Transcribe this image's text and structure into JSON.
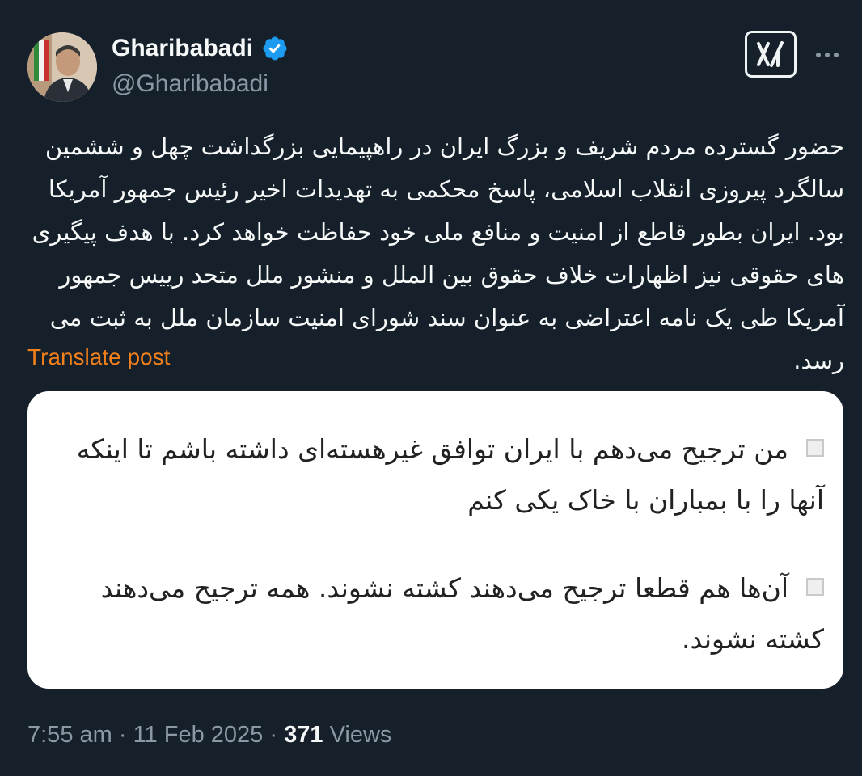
{
  "author": {
    "display_name": "Gharibabadi",
    "handle": "@Gharibabadi",
    "verified": true,
    "verified_color": "#1d9bf0"
  },
  "header": {
    "grok_icon": "grok-icon",
    "more_icon": "more-icon"
  },
  "tweet": {
    "text": "حضور گسترده مردم شریف و بزرگ ایران در راهپیمایی بزرگداشت چهل و ششمین سالگرد پیروزی انقلاب اسلامی، پاسخ محکمی به تهدیدات اخیر رئیس جمهور آمریکا بود. ایران بطور قاطع از امنیت و منافع ملی خود حفاظت خواهد کرد. با هدف پیگیری های حقوقی نیز اظهارات خلاف حقوق بین الملل و منشور ملل متحد رییس جمهور آمریکا طی یک نامه اعتراضی به عنوان سند شورای امنیت سازمان ملل به ثبت می رسد.",
    "translate_label": "Translate post"
  },
  "media": {
    "item1": "من ترجیح می‌دهم با ایران توافق غیرهسته‌ای داشته باشم تا اینکه آنها را با بمباران با خاک یکی کنم",
    "item2": "آن‌ها هم قطعا ترجیح می‌دهند کشته نشوند. همه ترجیح می‌دهند کشته نشوند."
  },
  "meta": {
    "time": "7:55 am",
    "separator": "·",
    "date": "11 Feb 2025",
    "views_count": "371",
    "views_label": "Views"
  },
  "colors": {
    "background": "#15202b",
    "text": "#f7f9f9",
    "secondary": "#8b98a5",
    "translate": "#f4801a"
  }
}
